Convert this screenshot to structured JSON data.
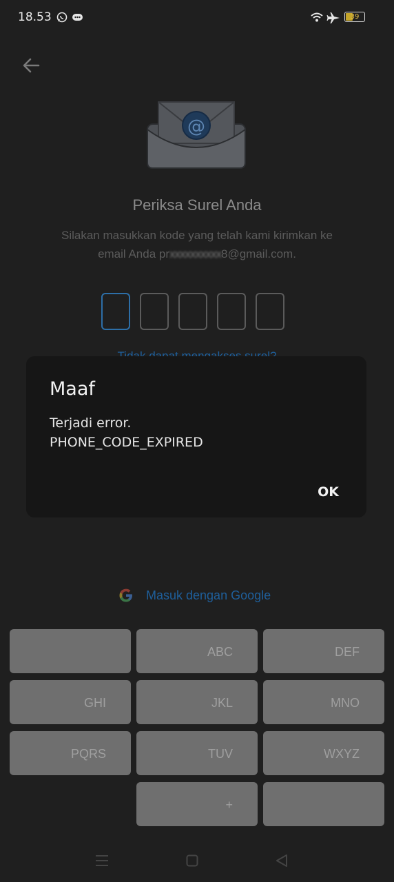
{
  "status_bar": {
    "time": "18.53",
    "battery": "39",
    "icons": [
      "whatsapp-icon",
      "message-icon",
      "wifi-icon",
      "airplane-icon",
      "battery-icon"
    ]
  },
  "header": {
    "back_icon": "arrow-left-icon"
  },
  "content": {
    "title": "Periksa Surel Anda",
    "subtitle_line1": "Silakan masukkan kode yang telah kami kirimkan ke",
    "subtitle_prefix": "email Anda pr",
    "subtitle_masked": "xxxxxxxxxx",
    "subtitle_suffix": "8@gmail.com.",
    "code_box_count": 5,
    "help_link": "Tidak dapat mengakses surel?",
    "google_label": "Masuk dengan Google"
  },
  "dialog": {
    "title": "Maaf",
    "message_line1": "Terjadi error.",
    "message_line2": "PHONE_CODE_EXPIRED",
    "ok_label": "OK"
  },
  "keypad": {
    "keys": [
      "",
      "ABC",
      "DEF",
      "GHI",
      "JKL",
      "MNO",
      "PQRS",
      "TUV",
      "WXYZ",
      "",
      "+",
      ""
    ]
  },
  "nav_bar": {
    "icons": [
      "menu-icon",
      "home-icon",
      "back-triangle-icon"
    ]
  },
  "colors": {
    "accent": "#2d6fa8",
    "link": "#1f5f9b",
    "dialog_bg": "#161616",
    "overlay_bg": "#1f1f1f"
  }
}
